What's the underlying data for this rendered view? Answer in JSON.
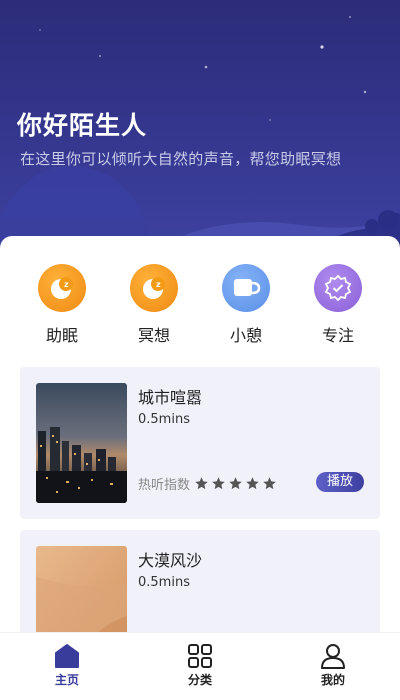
{
  "colors": {
    "accent": "#3a3c9c",
    "orange": "#f39a17",
    "blue": "#6b9ff0",
    "purple": "#9b73e0",
    "card_bg": "#f1f1fa"
  },
  "hero": {
    "title": "你好陌生人",
    "subtitle": "在这里你可以倾听大自然的声音，帮您助眠冥想"
  },
  "categories": [
    {
      "label": "助眠",
      "icon": "moon-sleep-icon"
    },
    {
      "label": "冥想",
      "icon": "moon-meditate-icon"
    },
    {
      "label": "小憩",
      "icon": "cup-icon"
    },
    {
      "label": "专注",
      "icon": "focus-badge-icon"
    }
  ],
  "sounds": [
    {
      "title": "城市喧嚣",
      "duration": "0.5mins",
      "heat_label": "热听指数",
      "rating": 5,
      "play_label": "播放",
      "image": "city-night-image"
    },
    {
      "title": "大漠风沙",
      "duration": "0.5mins",
      "image": "desert-dune-image"
    }
  ],
  "tabbar": [
    {
      "label": "主页",
      "icon": "home-icon",
      "active": true
    },
    {
      "label": "分类",
      "icon": "grid-icon",
      "active": false
    },
    {
      "label": "我的",
      "icon": "user-icon",
      "active": false
    }
  ]
}
